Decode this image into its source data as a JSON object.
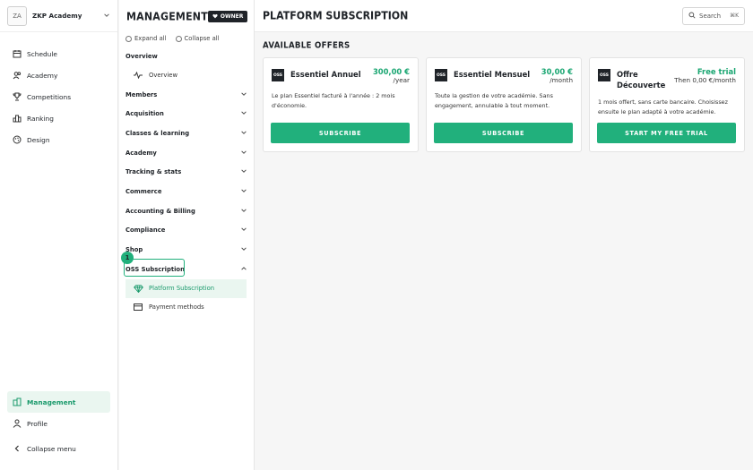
{
  "brand": {
    "avatar": "ZA",
    "name": "ZKP Academy"
  },
  "left_nav": {
    "items": [
      {
        "label": "Schedule",
        "icon": "calendar-icon"
      },
      {
        "label": "Academy",
        "icon": "users-icon"
      },
      {
        "label": "Competitions",
        "icon": "trophy-icon"
      },
      {
        "label": "Ranking",
        "icon": "ranking-icon"
      },
      {
        "label": "Design",
        "icon": "palette-icon"
      }
    ],
    "bottom": [
      {
        "label": "Management",
        "icon": "building-icon",
        "active": true
      },
      {
        "label": "Profile",
        "icon": "user-icon"
      },
      {
        "label": "Collapse menu",
        "icon": "chevron-left-icon"
      }
    ]
  },
  "panel": {
    "title": "MANAGEMENT",
    "owner_badge": "OWNER",
    "expand_all": "Expand all",
    "collapse_all": "Collapse all",
    "overview_section": "Overview",
    "overview_item": "Overview",
    "sections": [
      "Members",
      "Acquisition",
      "Classes & learning",
      "Academy",
      "Tracking & stats",
      "Commerce",
      "Accounting & Billing",
      "Compliance",
      "Shop"
    ],
    "oss_section": "OSS Subscription",
    "oss_step": "1",
    "oss_items": [
      {
        "label": "Platform Subscription",
        "icon": "diamond-icon",
        "active": true
      },
      {
        "label": "Payment methods",
        "icon": "credit-card-icon"
      }
    ]
  },
  "main": {
    "title": "PLATFORM SUBSCRIPTION",
    "search_label": "Search",
    "search_kbd": "⌘K",
    "section": "AVAILABLE OFFERS",
    "offers": [
      {
        "logo": "OSS",
        "name": "Essentiel Annuel",
        "price": "300,00 €",
        "period": "/year",
        "desc": "Le plan Essentiel facturé à l'année : 2 mois d'économie.",
        "button": "SUBSCRIBE"
      },
      {
        "logo": "OSS",
        "name": "Essentiel Mensuel",
        "price": "30,00 €",
        "period": "/month",
        "desc": "Toute la gestion de votre académie. Sans engagement, annulable à tout moment.",
        "button": "SUBSCRIBE"
      },
      {
        "logo": "OSS",
        "name": "Offre Découverte",
        "price": "Free trial",
        "period": "Then 0,00 €/month",
        "desc": "1 mois offert, sans carte bancaire. Choisissez ensuite le plan adapté à votre académie.",
        "button": "START MY FREE TRIAL"
      }
    ]
  },
  "colors": {
    "accent": "#21b07c",
    "accent_text": "#1aa672",
    "active_bg": "#eaf6f0"
  }
}
